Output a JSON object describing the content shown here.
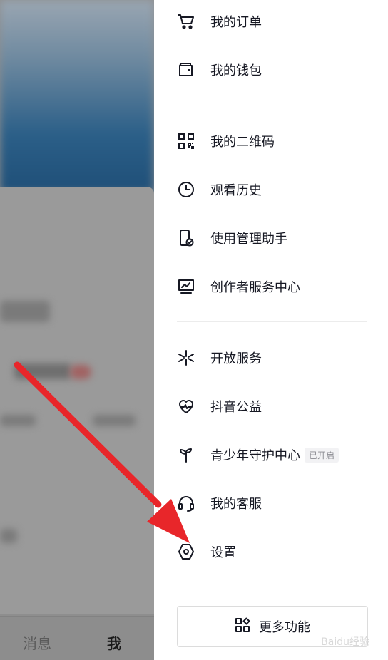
{
  "drawer": {
    "items_top": [
      {
        "label": "我的订单",
        "icon": "cart-icon"
      },
      {
        "label": "我的钱包",
        "icon": "wallet-icon"
      }
    ],
    "items_mid": [
      {
        "label": "我的二维码",
        "icon": "qr-code-icon"
      },
      {
        "label": "观看历史",
        "icon": "clock-icon"
      },
      {
        "label": "使用管理助手",
        "icon": "phone-check-icon"
      },
      {
        "label": "创作者服务中心",
        "icon": "monitor-chart-icon"
      }
    ],
    "items_bottom": [
      {
        "label": "开放服务",
        "icon": "sparkle-icon"
      },
      {
        "label": "抖音公益",
        "icon": "heart-pulse-icon"
      },
      {
        "label": "青少年守护中心",
        "icon": "sprout-icon",
        "badge": "已开启"
      },
      {
        "label": "我的客服",
        "icon": "headset-icon"
      },
      {
        "label": "设置",
        "icon": "hexagon-settings-icon"
      }
    ],
    "more_button": "更多功能"
  },
  "tabbar": {
    "messages": "消息",
    "me": "我"
  },
  "watermark": "Baidu经验",
  "colors": {
    "arrow": "#e8262a",
    "text": "#161823"
  }
}
